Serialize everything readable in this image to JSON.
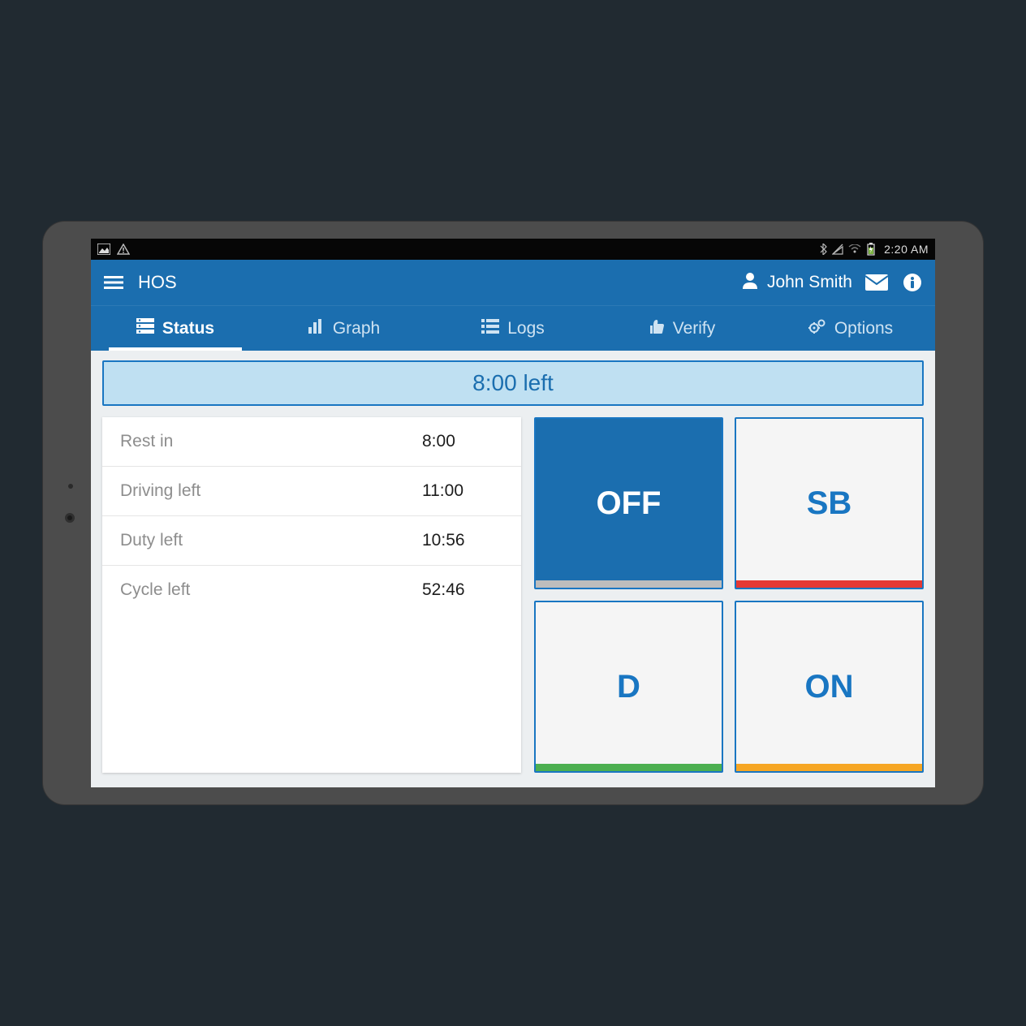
{
  "android_status": {
    "clock": "2:20 AM"
  },
  "header": {
    "app_title": "HOS",
    "user_name": "John Smith"
  },
  "tabs": {
    "status": "Status",
    "graph": "Graph",
    "logs": "Logs",
    "verify": "Verify",
    "options": "Options",
    "active": "status"
  },
  "banner": "8:00 left",
  "stats": {
    "rest_in": {
      "label": "Rest in",
      "value": "8:00"
    },
    "driving_left": {
      "label": "Driving left",
      "value": "11:00"
    },
    "duty_left": {
      "label": "Duty left",
      "value": "10:56"
    },
    "cycle_left": {
      "label": "Cycle left",
      "value": "52:46"
    }
  },
  "duty_buttons": {
    "off": {
      "label": "OFF",
      "underline": "gray",
      "selected": true
    },
    "sb": {
      "label": "SB",
      "underline": "red",
      "selected": false
    },
    "d": {
      "label": "D",
      "underline": "green",
      "selected": false
    },
    "on": {
      "label": "ON",
      "underline": "amber",
      "selected": false
    }
  }
}
